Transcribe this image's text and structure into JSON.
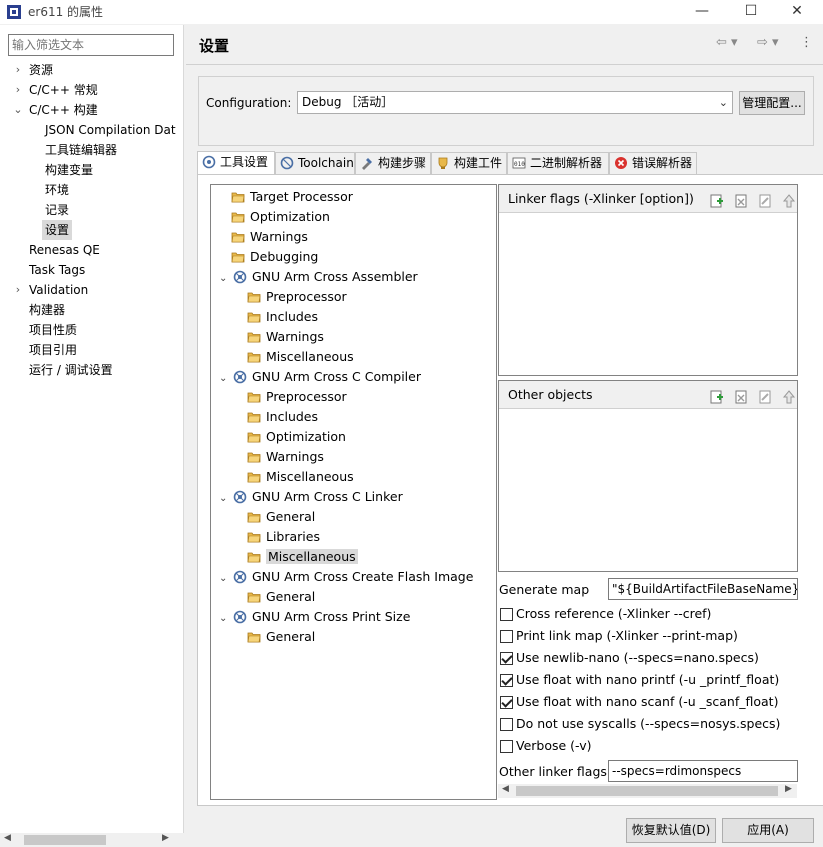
{
  "window": {
    "title": "er611 的属性",
    "minimize": "—",
    "maximize": "☐",
    "close": "✕"
  },
  "filter": {
    "placeholder": "输入筛选文本"
  },
  "nav": {
    "items": [
      {
        "label": "资源",
        "expandable": true
      },
      {
        "label": "C/C++ 常规",
        "expandable": true
      },
      {
        "label": "C/C++ 构建",
        "expandable": true,
        "expanded": true
      },
      {
        "label": "JSON Compilation Dat"
      },
      {
        "label": "工具链编辑器"
      },
      {
        "label": "构建变量"
      },
      {
        "label": "环境"
      },
      {
        "label": "记录"
      },
      {
        "label": "设置",
        "selected": true
      },
      {
        "label": "Renesas QE"
      },
      {
        "label": "Task Tags"
      },
      {
        "label": "Validation",
        "expandable": true
      },
      {
        "label": "构建器"
      },
      {
        "label": "项目性质"
      },
      {
        "label": "项目引用"
      },
      {
        "label": "运行 / 调试设置"
      }
    ]
  },
  "page": {
    "title": "设置",
    "nav_back": "⇦ ▾",
    "nav_forward": "⇨ ▾",
    "menu": "⋮"
  },
  "config": {
    "label": "Configuration:",
    "value": "Debug ［活动］",
    "manage_label": "管理配置..."
  },
  "tabs": [
    {
      "label": "工具设置",
      "active": true
    },
    {
      "label": "Toolchain"
    },
    {
      "label": "构建步骤"
    },
    {
      "label": "构建工件"
    },
    {
      "label": "二进制解析器"
    },
    {
      "label": "错误解析器"
    }
  ],
  "tree": [
    {
      "label": "Target Processor",
      "level": 0,
      "kind": "option"
    },
    {
      "label": "Optimization",
      "level": 0,
      "kind": "option"
    },
    {
      "label": "Warnings",
      "level": 0,
      "kind": "option"
    },
    {
      "label": "Debugging",
      "level": 0,
      "kind": "option"
    },
    {
      "label": "GNU Arm Cross Assembler",
      "level": 0,
      "kind": "tool"
    },
    {
      "label": "Preprocessor",
      "level": 1,
      "kind": "option"
    },
    {
      "label": "Includes",
      "level": 1,
      "kind": "option"
    },
    {
      "label": "Warnings",
      "level": 1,
      "kind": "option"
    },
    {
      "label": "Miscellaneous",
      "level": 1,
      "kind": "option"
    },
    {
      "label": "GNU Arm Cross C Compiler",
      "level": 0,
      "kind": "tool"
    },
    {
      "label": "Preprocessor",
      "level": 1,
      "kind": "option"
    },
    {
      "label": "Includes",
      "level": 1,
      "kind": "option"
    },
    {
      "label": "Optimization",
      "level": 1,
      "kind": "option"
    },
    {
      "label": "Warnings",
      "level": 1,
      "kind": "option"
    },
    {
      "label": "Miscellaneous",
      "level": 1,
      "kind": "option"
    },
    {
      "label": "GNU Arm Cross C Linker",
      "level": 0,
      "kind": "tool"
    },
    {
      "label": "General",
      "level": 1,
      "kind": "option"
    },
    {
      "label": "Libraries",
      "level": 1,
      "kind": "option"
    },
    {
      "label": "Miscellaneous",
      "level": 1,
      "kind": "option",
      "selected": true
    },
    {
      "label": "GNU Arm Cross Create Flash Image",
      "level": 0,
      "kind": "tool"
    },
    {
      "label": "General",
      "level": 1,
      "kind": "option"
    },
    {
      "label": "GNU Arm Cross Print Size",
      "level": 0,
      "kind": "tool"
    },
    {
      "label": "General",
      "level": 1,
      "kind": "option"
    }
  ],
  "linker_flags_panel": {
    "title": "Linker flags (-Xlinker [option])"
  },
  "other_objects_panel": {
    "title": "Other objects"
  },
  "generate_map": {
    "label": "Generate map",
    "value": "\"${BuildArtifactFileBaseName}.m"
  },
  "checkboxes": [
    {
      "label": "Cross reference (-Xlinker --cref)",
      "checked": false
    },
    {
      "label": "Print link map (-Xlinker --print-map)",
      "checked": false
    },
    {
      "label": "Use newlib-nano (--specs=nano.specs)",
      "checked": true
    },
    {
      "label": "Use float with nano printf (-u _printf_float)",
      "checked": true
    },
    {
      "label": "Use float with nano scanf (-u _scanf_float)",
      "checked": true
    },
    {
      "label": "Do not use syscalls (--specs=nosys.specs)",
      "checked": false
    },
    {
      "label": "Verbose (-v)",
      "checked": false
    }
  ],
  "other_linker_flags": {
    "label": "Other linker flags",
    "value": "--specs=rdimonspecs"
  },
  "buttons": {
    "restore_defaults": "恢复默认值(D)",
    "apply": "应用(A)"
  },
  "colors": {
    "tool_icon": "#4a6fa5",
    "folder_icon": "#e8b84a",
    "error_icon": "#d9322e",
    "selection": "#d9d9d9"
  }
}
